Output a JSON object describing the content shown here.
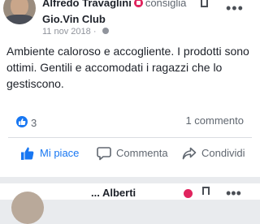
{
  "post": {
    "author": "Alfredo Travaglini",
    "verb": "consiglia",
    "page": "Gio.Vin Club",
    "date": "11 nov 2018",
    "text": "Ambiente caloroso e accogliente. I prodotti sono ottimi. Gentili e accomodati i ragazzi che lo gestiscono.",
    "likes": "3",
    "comments": "1 commento"
  },
  "actions": {
    "like": "Mi piace",
    "comment": "Commenta",
    "share": "Condividi"
  },
  "next_post": {
    "author_partial": "... Alberti"
  },
  "colors": {
    "brand_blue": "#1877f2",
    "recommend_badge": "#e0245e",
    "secondary_text": "#606770"
  }
}
